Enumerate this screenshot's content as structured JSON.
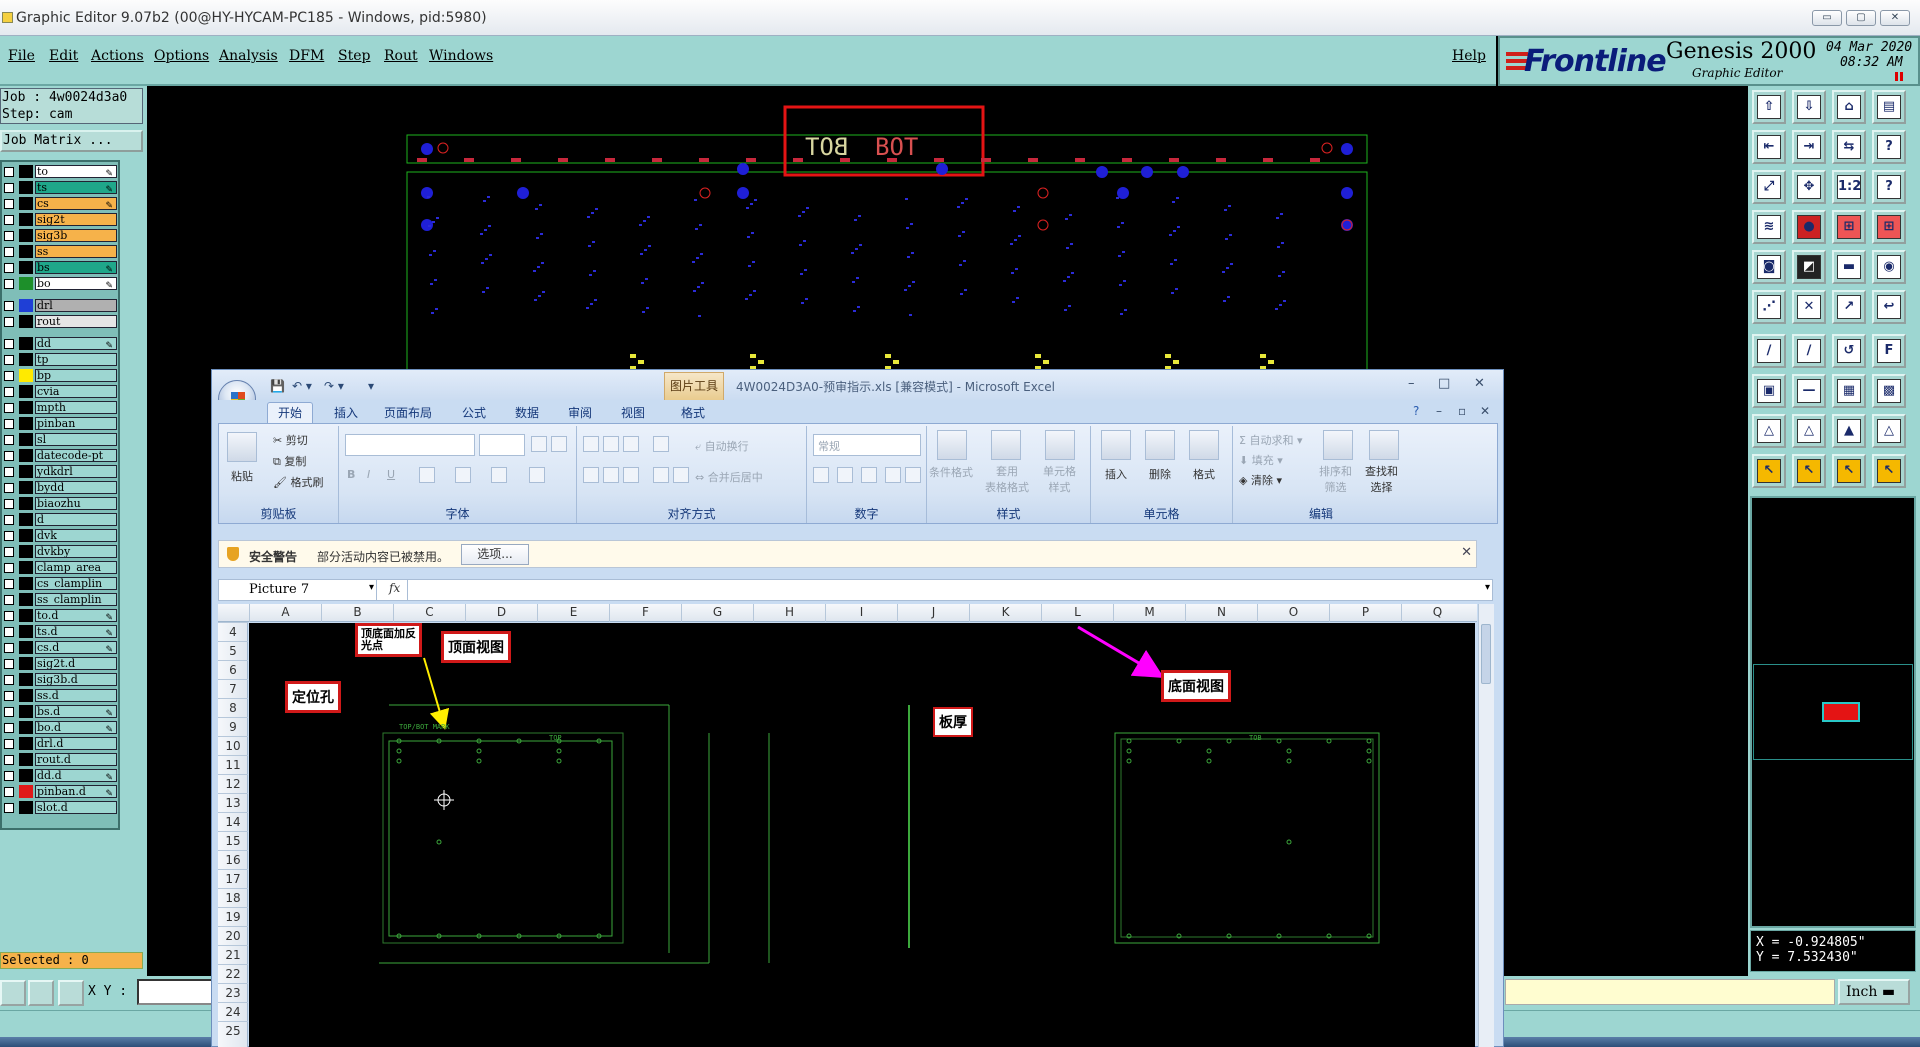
{
  "window": {
    "title": "Graphic Editor 9.07b2 (00@HY-HYCAM-PC185 - Windows, pid:5980)",
    "controls": {
      "minimize": "▭",
      "maximize": "▢",
      "close": "✕"
    }
  },
  "menu": {
    "items": [
      {
        "label": "File"
      },
      {
        "label": "Edit"
      },
      {
        "label": "Actions"
      },
      {
        "label": "Options"
      },
      {
        "label": "Analysis"
      },
      {
        "label": "DFM"
      },
      {
        "label": "Step"
      },
      {
        "label": "Rout"
      },
      {
        "label": "Windows"
      }
    ],
    "help": "Help"
  },
  "brand": {
    "logo": "Frontline",
    "product": "Genesis 2000",
    "subtitle": "Graphic Editor",
    "date": "04 Mar 2020",
    "time": "08:32 AM"
  },
  "job_panel": {
    "job": "Job : 4w0024d3a0",
    "step": "Step: cam",
    "job_matrix": "Job Matrix ...",
    "selected": "Selected : 0"
  },
  "layers": [
    {
      "name": "to",
      "color": "#ffffff",
      "swatch": "#000000",
      "pen": true
    },
    {
      "name": "ts",
      "color": "#1fa78a",
      "swatch": "#000000",
      "pen": true
    },
    {
      "name": "cs",
      "color": "#f6b24a",
      "swatch": "#000000",
      "pen": true
    },
    {
      "name": "sig2t",
      "color": "#f6b24a",
      "swatch": "#000000",
      "pen": false
    },
    {
      "name": "sig3b",
      "color": "#f6b24a",
      "swatch": "#000000",
      "pen": false
    },
    {
      "name": "ss",
      "color": "#f6b24a",
      "swatch": "#000000",
      "pen": false
    },
    {
      "name": "bs",
      "color": "#1fa78a",
      "swatch": "#000000",
      "pen": true
    },
    {
      "name": "bo",
      "color": "#ffffff",
      "swatch": "#1d8f2a",
      "pen": true
    },
    {
      "name": "drl",
      "color": "#b0b0b0",
      "swatch": "#1f3fd6",
      "pen": false
    },
    {
      "name": "rout",
      "color": "#e6e6e6",
      "swatch": "#000000",
      "pen": false
    },
    {
      "name": "dd",
      "color": "#9dd6d1",
      "swatch": "#000000",
      "pen": true
    },
    {
      "name": "tp",
      "color": "#9dd6d1",
      "swatch": "#000000",
      "pen": false
    },
    {
      "name": "bp",
      "color": "#9dd6d1",
      "swatch": "#ffea00",
      "pen": false
    },
    {
      "name": "cvia",
      "color": "#9dd6d1",
      "swatch": "#000000",
      "pen": false
    },
    {
      "name": "mpth",
      "color": "#9dd6d1",
      "swatch": "#000000",
      "pen": false
    },
    {
      "name": "pinban",
      "color": "#9dd6d1",
      "swatch": "#000000",
      "pen": false
    },
    {
      "name": "sl",
      "color": "#9dd6d1",
      "swatch": "#000000",
      "pen": false
    },
    {
      "name": "datecode-pt",
      "color": "#9dd6d1",
      "swatch": "#000000",
      "pen": false
    },
    {
      "name": "ydkdrl",
      "color": "#9dd6d1",
      "swatch": "#000000",
      "pen": false
    },
    {
      "name": "bydd",
      "color": "#9dd6d1",
      "swatch": "#000000",
      "pen": false
    },
    {
      "name": "biaozhu",
      "color": "#9dd6d1",
      "swatch": "#000000",
      "pen": false
    },
    {
      "name": "d",
      "color": "#9dd6d1",
      "swatch": "#000000",
      "pen": false
    },
    {
      "name": "dvk",
      "color": "#9dd6d1",
      "swatch": "#000000",
      "pen": false
    },
    {
      "name": "dvkby",
      "color": "#9dd6d1",
      "swatch": "#000000",
      "pen": false
    },
    {
      "name": "clamp_area",
      "color": "#9dd6d1",
      "swatch": "#000000",
      "pen": false
    },
    {
      "name": "cs_clamplin",
      "color": "#9dd6d1",
      "swatch": "#000000",
      "pen": false
    },
    {
      "name": "ss_clamplin",
      "color": "#9dd6d1",
      "swatch": "#000000",
      "pen": false
    },
    {
      "name": "to.d",
      "color": "#9dd6d1",
      "swatch": "#000000",
      "pen": true
    },
    {
      "name": "ts.d",
      "color": "#9dd6d1",
      "swatch": "#000000",
      "pen": true
    },
    {
      "name": "cs.d",
      "color": "#9dd6d1",
      "swatch": "#000000",
      "pen": true
    },
    {
      "name": "sig2t.d",
      "color": "#9dd6d1",
      "swatch": "#000000",
      "pen": false
    },
    {
      "name": "sig3b.d",
      "color": "#9dd6d1",
      "swatch": "#000000",
      "pen": false
    },
    {
      "name": "ss.d",
      "color": "#9dd6d1",
      "swatch": "#000000",
      "pen": false
    },
    {
      "name": "bs.d",
      "color": "#9dd6d1",
      "swatch": "#000000",
      "pen": true
    },
    {
      "name": "bo.d",
      "color": "#9dd6d1",
      "swatch": "#000000",
      "pen": true
    },
    {
      "name": "drl.d",
      "color": "#9dd6d1",
      "swatch": "#000000",
      "pen": false
    },
    {
      "name": "rout.d",
      "color": "#9dd6d1",
      "swatch": "#000000",
      "pen": false
    },
    {
      "name": "dd.d",
      "color": "#9dd6d1",
      "swatch": "#000000",
      "pen": true
    },
    {
      "name": "pinban.d",
      "color": "#9dd6d1",
      "swatch": "#e01919",
      "pen": true
    },
    {
      "name": "slot.d",
      "color": "#9dd6d1",
      "swatch": "#000000",
      "pen": false
    }
  ],
  "pcb": {
    "marks": [
      "BOT",
      "BOT"
    ]
  },
  "bottom": {
    "xy_label": "X Y :",
    "unit": "Inch"
  },
  "coords": {
    "x": "X = -0.924805\"",
    "y": "Y = 7.532430\""
  },
  "excel": {
    "context_tab": "图片工具",
    "title": "4W0024D3A0-预审指示.xls [兼容模式] - Microsoft Excel",
    "tabs": [
      "开始",
      "插入",
      "页面布局",
      "公式",
      "数据",
      "审阅",
      "视图",
      "格式"
    ],
    "ribbon": {
      "clipboard": {
        "group": "剪贴板",
        "paste": "粘贴",
        "cut": "剪切",
        "copy": "复制",
        "format_painter": "格式刷"
      },
      "font": {
        "group": "字体"
      },
      "alignment": {
        "group": "对齐方式",
        "wrap": "自动换行",
        "merge": "合并后居中"
      },
      "number": {
        "group": "数字",
        "format": "常规"
      },
      "styles": {
        "group": "样式",
        "conditional": "条件格式",
        "table": "套用\n表格格式",
        "cell": "单元格\n样式"
      },
      "cells": {
        "group": "单元格",
        "insert": "插入",
        "delete": "删除",
        "format": "格式"
      },
      "editing": {
        "group": "编辑",
        "autosum": "自动求和",
        "fill": "填充",
        "clear": "清除",
        "sort": "排序和\n筛选",
        "find": "查找和\n选择"
      }
    },
    "security": {
      "warning": "安全警告",
      "message": "部分活动内容已被禁用。",
      "options": "选项..."
    },
    "name_box": "Picture 7",
    "fx": "fx",
    "columns": [
      "A",
      "B",
      "C",
      "D",
      "E",
      "F",
      "G",
      "H",
      "I",
      "J",
      "K",
      "L",
      "M",
      "N",
      "O",
      "P",
      "Q"
    ],
    "rows": [
      "4",
      "5",
      "6",
      "7",
      "8",
      "9",
      "10",
      "11",
      "12",
      "13",
      "14",
      "15",
      "16",
      "17",
      "18",
      "19",
      "20",
      "21",
      "22",
      "23",
      "24",
      "25"
    ],
    "annotations": {
      "positioning_hole": "定位孔",
      "reflective_point": "顶底面加反\n光点",
      "top_view": "顶面视图",
      "bottom_view": "底面视图",
      "thickness": "板厚"
    },
    "drawing_labels": {
      "top_mark": "TOP/BOT MARK",
      "top": "TOP",
      "tob": "TOB"
    }
  },
  "colors": {
    "accent": "#9dd6d1",
    "annotation_border": "#d01919",
    "arrow_pink": "#ff00ff",
    "arrow_yellow": "#ffee00"
  }
}
